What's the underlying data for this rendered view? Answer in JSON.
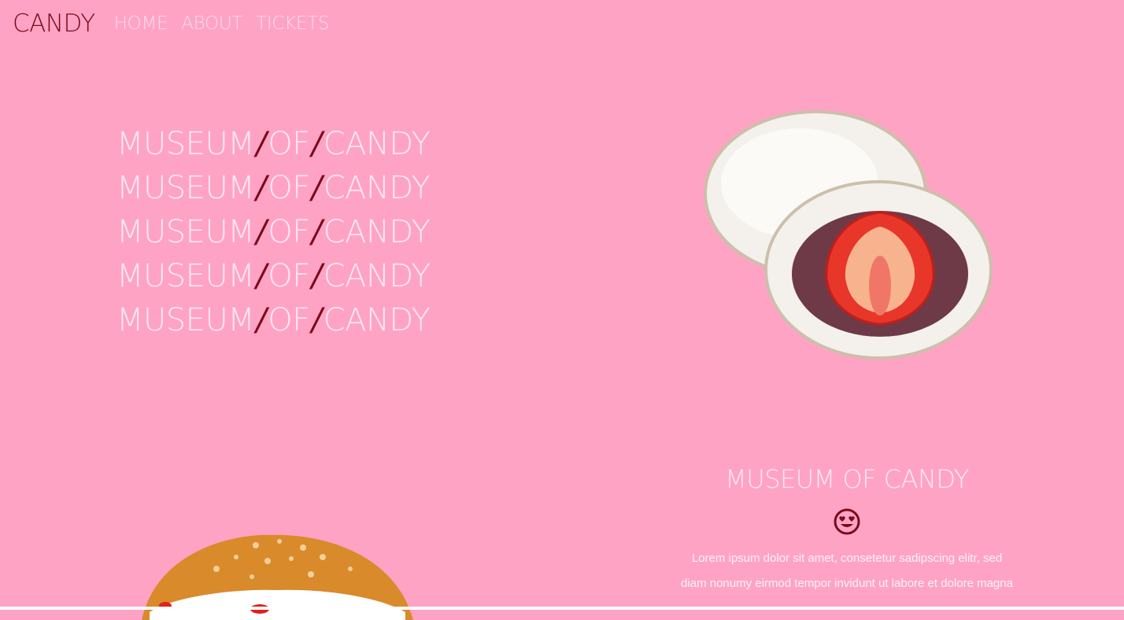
{
  "nav": {
    "brand": "CANDY",
    "links": [
      "HOME",
      "ABOUT",
      "TICKETS"
    ]
  },
  "headline": {
    "lines": [
      [
        "MUSEUM",
        "/",
        " OF ",
        "/",
        "CANDY"
      ],
      [
        "MUSEUM ",
        "/",
        "OF ",
        "/",
        "CANDY"
      ],
      [
        "MUSEUM",
        "/",
        " OF ",
        "/",
        "CANDY"
      ],
      [
        "MUSEUM",
        "/",
        " OF ",
        "/",
        "CANDY"
      ],
      [
        "MUSEUM ",
        "/",
        "OF ",
        "/",
        "CANDY"
      ]
    ]
  },
  "info": {
    "title": "MUSEUM OF CANDY",
    "emoji_icon": "heart-eyes-face-icon",
    "lorem_lines": [
      "Lorem ipsum dolor sit amet, consetetur sadipscing elitr, sed",
      "diam nonumy eirmod tempor invidunt ut labore et dolore magna"
    ]
  },
  "colors": {
    "background": "#ffa3c5",
    "accent": "#7a0a1a",
    "text_light": "#ffe9f1"
  }
}
